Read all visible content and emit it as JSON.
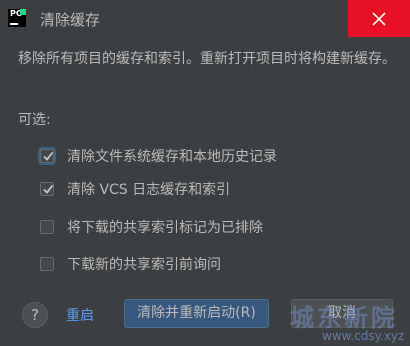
{
  "window": {
    "title": "清除缓存",
    "app_icon": "pycharm-icon",
    "app_icon_text": "PC"
  },
  "message": "移除所有项目的缓存和索引。重新打开项目时将构建新缓存。",
  "optional_label": "可选:",
  "options": [
    {
      "label": "清除文件系统缓存和本地历史记录",
      "checked": true,
      "focused": true
    },
    {
      "label": "清除 VCS 日志缓存和索引",
      "checked": true,
      "focused": false
    },
    {
      "label": "将下载的共享索引标记为已排除",
      "checked": false,
      "focused": false
    },
    {
      "label": "下载新的共享索引前询问",
      "checked": false,
      "focused": false
    }
  ],
  "footer": {
    "help_label": "?",
    "restart_label": "重启",
    "primary_label": "清除并重新启动(R)",
    "cancel_label": "取消"
  },
  "watermark": {
    "text": "城东新院",
    "url": "www.cdsy.xyz"
  },
  "colors": {
    "background": "#3c3f41",
    "close_hover": "#e81123",
    "primary_button": "#365880",
    "link": "#589df6",
    "text": "#bbbbbb"
  }
}
